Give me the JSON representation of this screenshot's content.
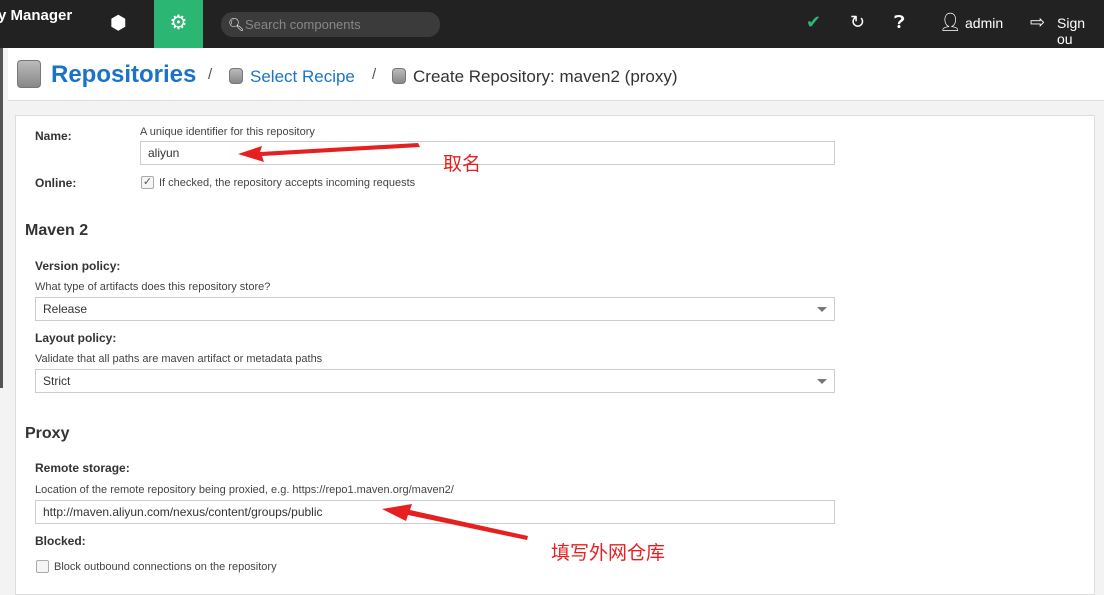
{
  "topbar": {
    "brand": "y Manager",
    "search_placeholder": "Search components",
    "user": "admin",
    "signout": "Sign ou"
  },
  "breadcrumb": {
    "title": "Repositories",
    "step1": "Select Recipe",
    "step2": "Create Repository: maven2 (proxy)",
    "sep": "/"
  },
  "form": {
    "name_label": "Name:",
    "name_help": "A unique identifier for this repository",
    "name_value": "aliyun",
    "online_label": "Online:",
    "online_help": "If checked, the repository accepts incoming requests",
    "online_checked": true,
    "maven_section": "Maven 2",
    "version_label": "Version policy:",
    "version_help": "What type of artifacts does this repository store?",
    "version_value": "Release",
    "layout_label": "Layout policy:",
    "layout_help": "Validate that all paths are maven artifact or metadata paths",
    "layout_value": "Strict",
    "proxy_section": "Proxy",
    "remote_label": "Remote storage:",
    "remote_help": "Location of the remote repository being proxied, e.g. https://repo1.maven.org/maven2/",
    "remote_value": "http://maven.aliyun.com/nexus/content/groups/public",
    "blocked_label": "Blocked:",
    "blocked_help": "Block outbound connections on the repository",
    "blocked_checked": false
  },
  "annotations": {
    "name_note": "取名",
    "remote_note": "填写外网仓库",
    "color": "#e62020"
  },
  "colors": {
    "accent": "#2bb673",
    "link": "#1a73c8",
    "topbar": "#222222"
  }
}
